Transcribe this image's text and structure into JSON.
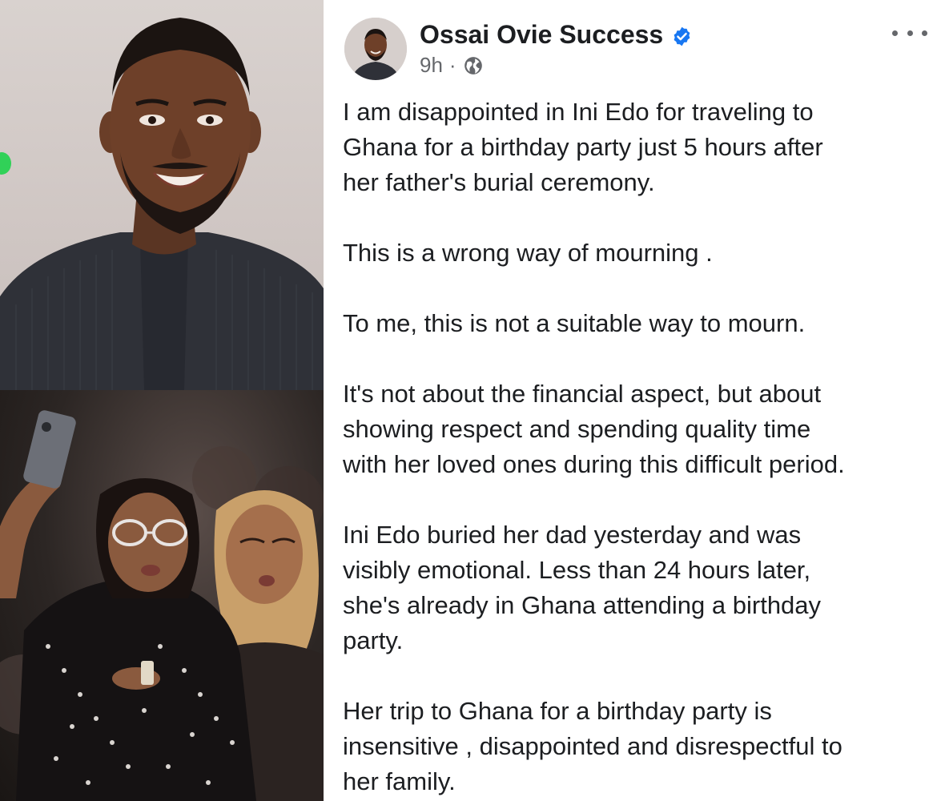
{
  "post": {
    "author": "Ossai Ovie Success",
    "time": "9h",
    "separator": "·",
    "icons": {
      "verified": "verified-badge-icon",
      "audience": "globe-icon",
      "more": "more-options-icon"
    },
    "paragraphs": [
      {
        "lines": [
          "I am disappointed in Ini Edo for traveling to",
          "Ghana for a birthday party just 5 hours after",
          "her father's burial ceremony."
        ]
      },
      {
        "lines": [
          "This is a wrong way of mourning ."
        ]
      },
      {
        "lines": [
          "To me, this is not a suitable way to mourn."
        ]
      },
      {
        "lines": [
          "It's not about the financial aspect, but about",
          "showing respect and spending quality time",
          "with her loved ones during this difficult period."
        ]
      },
      {
        "lines": [
          "Ini Edo buried her dad yesterday and was",
          "visibly emotional. Less than 24 hours later,",
          "she's already in Ghana attending a birthday",
          "party."
        ]
      },
      {
        "lines": [
          "Her trip to Ghana for a birthday party is",
          "insensitive , disappointed and disrespectful to",
          "her family."
        ]
      }
    ]
  },
  "colors": {
    "verified": "#1877f2",
    "text": "#1c1e21",
    "secondary": "#65676b",
    "online": "#31d158"
  }
}
